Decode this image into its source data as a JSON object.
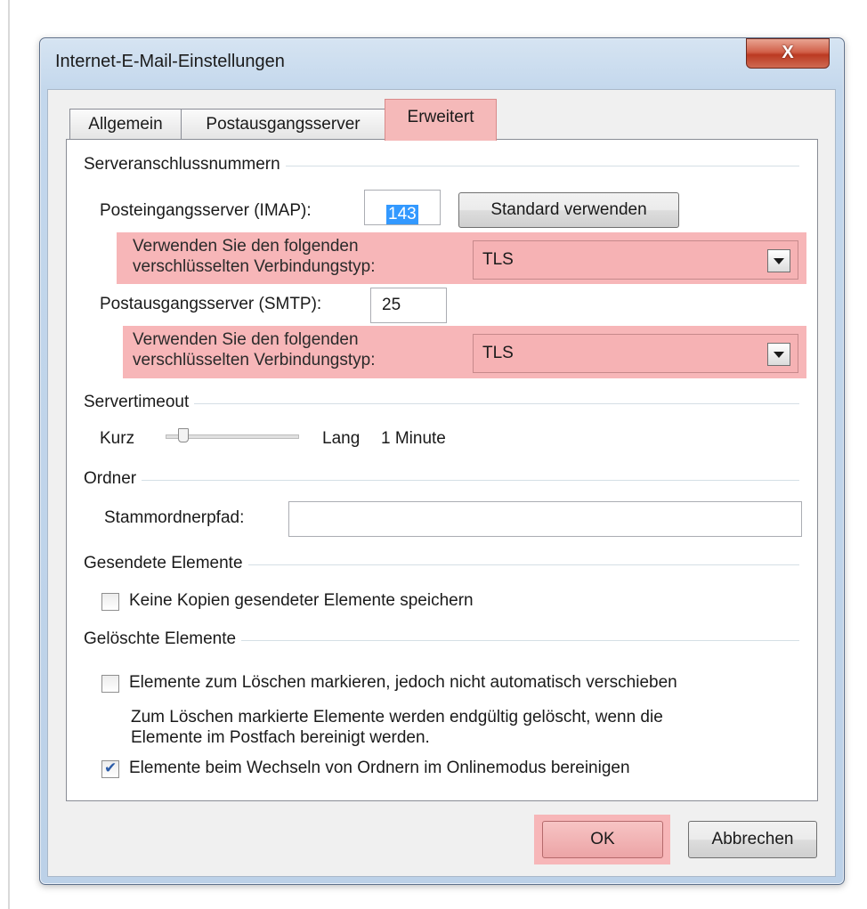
{
  "window": {
    "title": "Internet-E-Mail-Einstellungen",
    "close_label": "X"
  },
  "tabs": [
    {
      "label": "Allgemein",
      "active": false
    },
    {
      "label": "Postausgangsserver",
      "active": false
    },
    {
      "label": "Erweitert",
      "active": true
    }
  ],
  "server_ports": {
    "group_label": "Serveranschlussnummern",
    "incoming_label": "Posteingangsserver (IMAP):",
    "incoming_value": "143",
    "default_button": "Standard verwenden",
    "incoming_encryption_label_1": "Verwenden Sie den folgenden",
    "incoming_encryption_label_2": "verschlüsselten Verbindungstyp:",
    "incoming_encryption_value": "TLS",
    "outgoing_label": "Postausgangsserver (SMTP):",
    "outgoing_value": "25",
    "outgoing_encryption_label_1": "Verwenden Sie den folgenden",
    "outgoing_encryption_label_2": "verschlüsselten Verbindungstyp:",
    "outgoing_encryption_value": "TLS"
  },
  "timeout": {
    "group_label": "Servertimeout",
    "short_label": "Kurz",
    "long_label": "Lang",
    "value_text": "1 Minute",
    "slider_level": 0.1
  },
  "folders": {
    "group_label": "Ordner",
    "root_path_label": "Stammordnerpfad:",
    "root_path_value": ""
  },
  "sent_items": {
    "group_label": "Gesendete Elemente",
    "no_copies_label": "Keine Kopien gesendeter Elemente speichern",
    "no_copies_checked": false
  },
  "deleted_items": {
    "group_label": "Gelöschte Elemente",
    "mark_label": "Elemente zum Löschen markieren, jedoch nicht automatisch verschieben",
    "mark_checked": false,
    "note_line_1": "Zum Löschen markierte Elemente werden endgültig gelöscht, wenn die",
    "note_line_2": "Elemente im Postfach bereinigt werden.",
    "purge_label": "Elemente beim Wechseln von Ordnern im Onlinemodus bereinigen",
    "purge_checked": true
  },
  "footer": {
    "ok_label": "OK",
    "cancel_label": "Abbrechen"
  },
  "colors": {
    "highlight": "#f7b6b8",
    "selection": "#3399ff",
    "close_button": "#c9452c"
  }
}
